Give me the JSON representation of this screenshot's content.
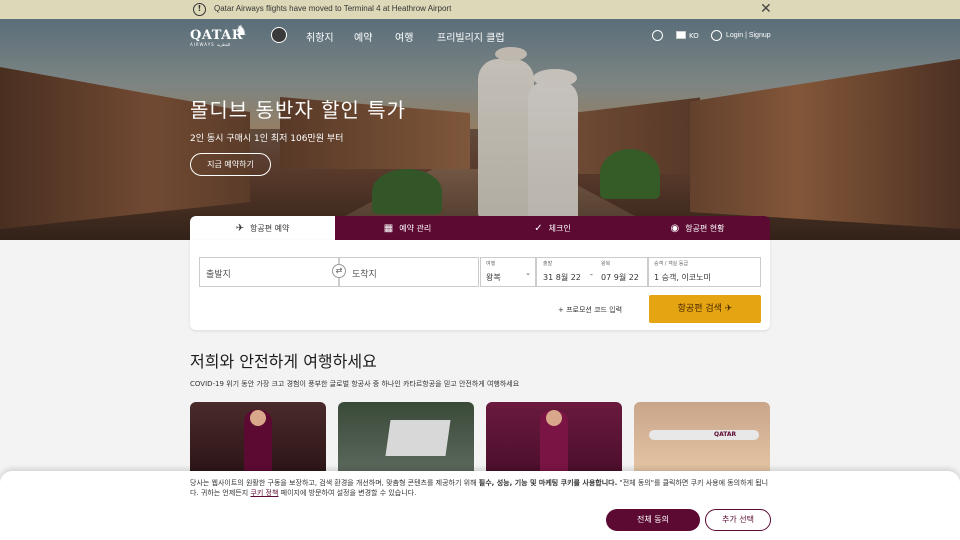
{
  "announcement": {
    "text": "Qatar Airways flights have moved to Terminal 4 at Heathrow Airport",
    "icon": "info-icon"
  },
  "nav": {
    "logo_word": "QATAR",
    "logo_sub": "AIRWAYS القطرية",
    "items": [
      "취항지",
      "예약",
      "여행",
      "프리빌리지 클럽"
    ],
    "lang": "KO",
    "login": "Login | Signup"
  },
  "hero": {
    "title": "몰디브 동반자 할인 특가",
    "subtitle": "2인 동시 구매시 1인 최저 106만원 부터",
    "cta": "지금 예약하기"
  },
  "booking": {
    "tabs": [
      {
        "label": "항공편 예약",
        "icon": "plane-icon"
      },
      {
        "label": "예약 관리",
        "icon": "calendar-icon"
      },
      {
        "label": "체크인",
        "icon": "check-circle-icon"
      },
      {
        "label": "항공편 현황",
        "icon": "location-pin-icon"
      }
    ],
    "from_placeholder": "출발지",
    "to_placeholder": "도착지",
    "trip_label": "여행",
    "trip_value": "왕복",
    "depart_label": "출발",
    "depart_value": "31 8월 22",
    "return_label": "왕복",
    "return_value": "07 9월 22",
    "pax_label": "승객 / 객실 등급",
    "pax_value": "1 승객, 이코노미",
    "promo": "+ 프로모션 코드 입력",
    "search": "항공편 검색"
  },
  "section": {
    "title": "저희와 안전하게 여행하세요",
    "subtitle": "COVID-19 위기 동안 가장 크고 경험이 풍부한 글로벌 항공사 중 하나인 카타르항공을 믿고 안전하게 여행하세요",
    "card4_label": "QATAR"
  },
  "cookie": {
    "text_pre": "당사는 웹사이트의 원활한 구동을 보장하고, 검색 환경을 개선하며, 맞춤형 콘텐츠를 제공하기 위해 ",
    "text_bold": "필수, 성능, 기능 및 마케팅 쿠키를 사용합니다.",
    "text_mid": " \"전체 동의\"를 클릭하면 쿠키 사용에 동의하게 됩니다. 귀하는 언제든지 ",
    "link": "쿠키 정책",
    "text_post": " 페이지에 방문하여 설정을 변경할 수 있습니다.",
    "accept": "전체 동의",
    "more": "추가 선택"
  },
  "colors": {
    "brand": "#5c0a32",
    "accent": "#e5a512",
    "announce_bg": "#ddd9b8"
  }
}
